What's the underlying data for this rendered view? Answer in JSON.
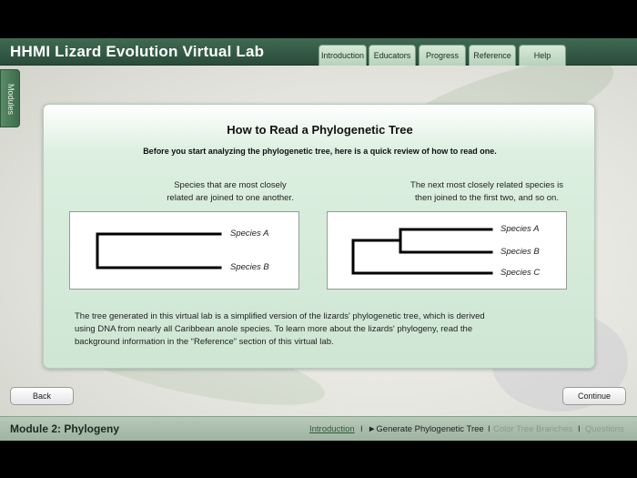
{
  "app": {
    "title": "HHMI Lizard Evolution Virtual Lab"
  },
  "nav": {
    "tabs": [
      {
        "label": "Introduction"
      },
      {
        "label": "Educators"
      },
      {
        "label": "Progress"
      },
      {
        "label": "Reference"
      },
      {
        "label": "Help"
      }
    ],
    "modules_label": "Modules"
  },
  "panel": {
    "title": "How to Read a Phylogenetic Tree",
    "subtitle": "Before you start analyzing the phylogenetic tree, here is a quick review of how to read one.",
    "left_caption_1": "Species that are most closely",
    "left_caption_2": "related are joined to one another.",
    "right_caption_1": "The next most closely related species is",
    "right_caption_2": "then joined to the first two, and so on.",
    "tree1": {
      "species": [
        "Species A",
        "Species B"
      ]
    },
    "tree2": {
      "species": [
        "Species A",
        "Species B",
        "Species C"
      ]
    },
    "paragraph_1": "The tree generated in this virtual lab is a simplified version of the lizards' phylogenetic tree, which is derived",
    "paragraph_2": "using DNA from nearly all Caribbean anole species. To learn more about the lizards' phylogeny, read the",
    "paragraph_3": "background information in the “Reference” section of this virtual lab."
  },
  "buttons": {
    "back": "Back",
    "continue": "Continue"
  },
  "footer": {
    "module": "Module 2: Phylogeny",
    "steps": [
      {
        "label": "Introduction",
        "state": "link"
      },
      {
        "label": "►Generate Phylogenetic Tree",
        "state": "current"
      },
      {
        "label": "Color Tree Branches",
        "state": "dim"
      },
      {
        "label": "Questions",
        "state": "dim"
      }
    ],
    "separator": "I"
  },
  "colors": {
    "header": "#2f5541",
    "panel": "#d6ecd9",
    "footer": "#aabdac",
    "accent": "#3d6b4b"
  }
}
